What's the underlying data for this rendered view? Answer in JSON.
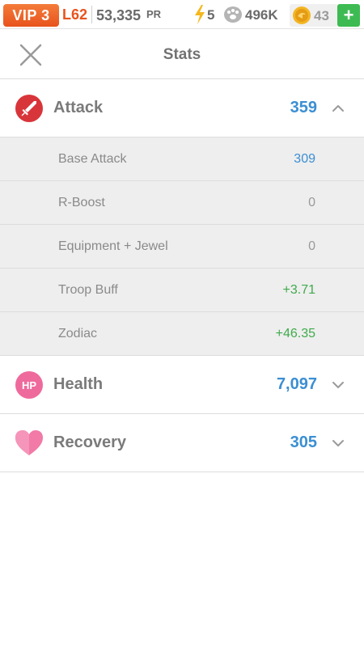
{
  "topbar": {
    "vip": "VIP 3",
    "level": "L62",
    "power": "53,335",
    "power_unit": "PR",
    "energy": "5",
    "food": "496K",
    "gems": "43",
    "plus": "+"
  },
  "header": {
    "title": "Stats"
  },
  "stats": {
    "attack": {
      "label": "Attack",
      "value": "359",
      "expanded": true,
      "details": [
        {
          "label": "Base Attack",
          "value": "309"
        },
        {
          "label": "R-Boost",
          "value": "0"
        },
        {
          "label": "Equipment + Jewel",
          "value": "0"
        },
        {
          "label": "Troop Buff",
          "value": "+3.71"
        },
        {
          "label": "Zodiac",
          "value": "+46.35"
        }
      ]
    },
    "health": {
      "label": "Health",
      "value": "7,097",
      "icon_text": "HP"
    },
    "recovery": {
      "label": "Recovery",
      "value": "305"
    }
  },
  "colors": {
    "accent_blue": "#3b8fd3",
    "positive_green": "#3faa4c",
    "vip_orange": "#e8531d",
    "attack_red": "#d8353a",
    "health_pink": "#ef6a9c",
    "recovery_pink": "#f27aa6"
  },
  "icons": {
    "attack": "sword-icon",
    "health": "hp-icon",
    "recovery": "heart-icon",
    "energy": "lightning-icon",
    "food": "paw-icon",
    "gems": "gem-coin-icon"
  }
}
